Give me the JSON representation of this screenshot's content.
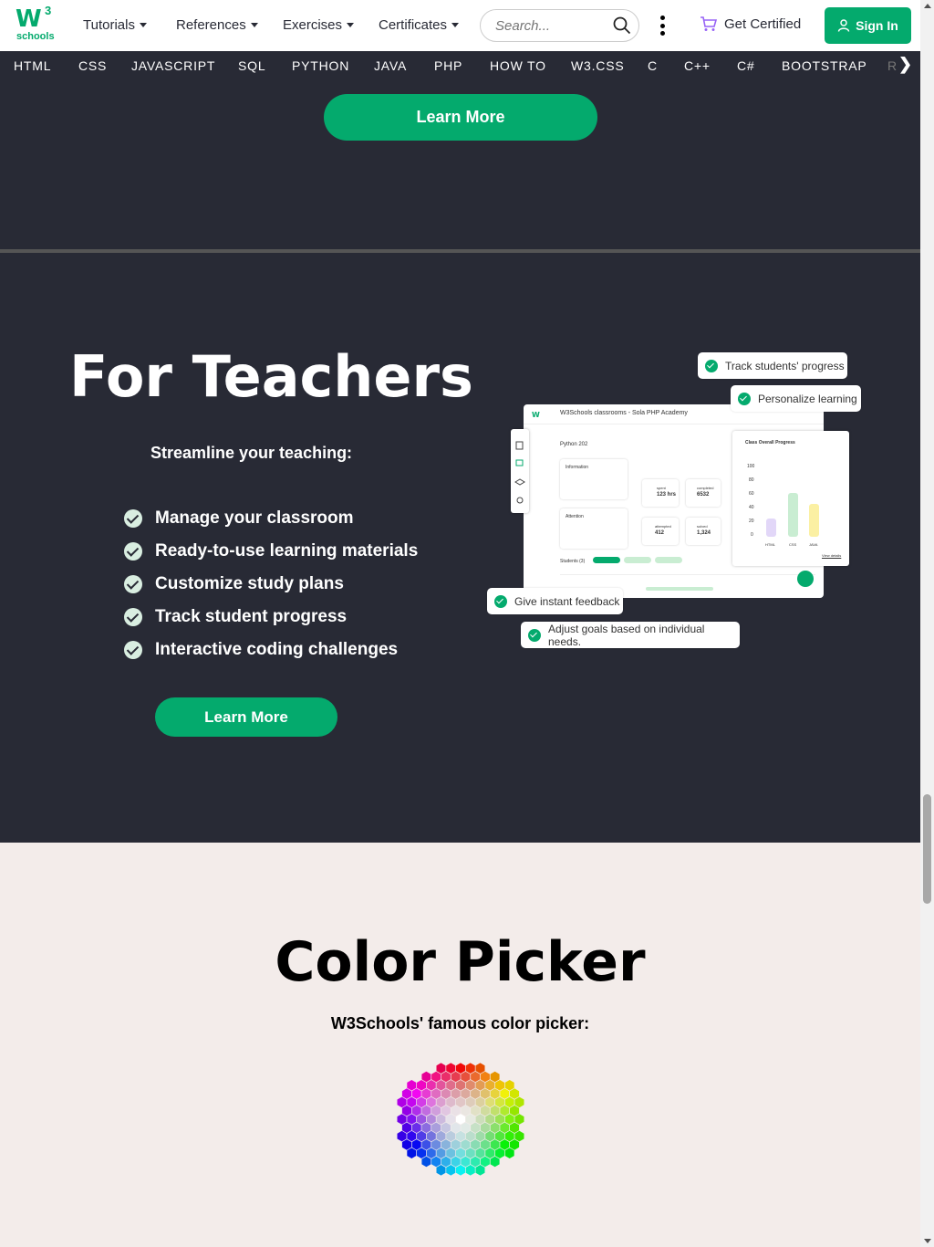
{
  "brand": {
    "mark": "W",
    "superscript": "3",
    "word": "schools"
  },
  "topnav": {
    "tutorials": "Tutorials",
    "references": "References",
    "exercises": "Exercises",
    "certificates": "Certificates",
    "search_placeholder": "Search...",
    "get_certified": "Get Certified",
    "sign_in": "Sign In"
  },
  "subnav": [
    "HTML",
    "CSS",
    "JAVASCRIPT",
    "SQL",
    "PYTHON",
    "JAVA",
    "PHP",
    "HOW TO",
    "W3.CSS",
    "C",
    "C++",
    "C#",
    "BOOTSTRAP",
    "R"
  ],
  "top_section": {
    "learn_more": "Learn More"
  },
  "teachers": {
    "title": "For Teachers",
    "subtitle": "Streamline your teaching:",
    "features": [
      "Manage your classroom",
      "Ready-to-use learning materials",
      "Customize study plans",
      "Track student progress",
      "Interactive coding challenges"
    ],
    "learn_more": "Learn More",
    "badges": {
      "track": "Track students' progress",
      "personalize": "Personalize learning",
      "feedback": "Give instant feedback",
      "adjust": "Adjust goals based on individual needs."
    },
    "mock": {
      "header": "W3Schools classrooms - Sola PHP Academy",
      "course": "Python 202",
      "progress_title": "Class Overall Progress",
      "info_label": "Information",
      "attention_label": "Attention",
      "students_label": "Students (3)",
      "stat1_label": "spent",
      "stat1": "123 hrs",
      "stat2_label": "completed",
      "stat2": "6532",
      "stat3_label": "attempted",
      "stat3": "412",
      "stat4_label": "solved",
      "stat4": "1,324",
      "axis": [
        "100",
        "80",
        "60",
        "40",
        "20",
        "0"
      ],
      "bars": [
        {
          "label": "HTML",
          "value": 25,
          "color": "#E2D7F8"
        },
        {
          "label": "CSS",
          "value": 60,
          "color": "#C9EDD2"
        },
        {
          "label": "JAVA",
          "value": 45,
          "color": "#FBF0A3"
        }
      ],
      "view_details": "View details"
    }
  },
  "color_picker": {
    "title": "Color Picker",
    "subtitle": "W3Schools' famous color picker:"
  }
}
